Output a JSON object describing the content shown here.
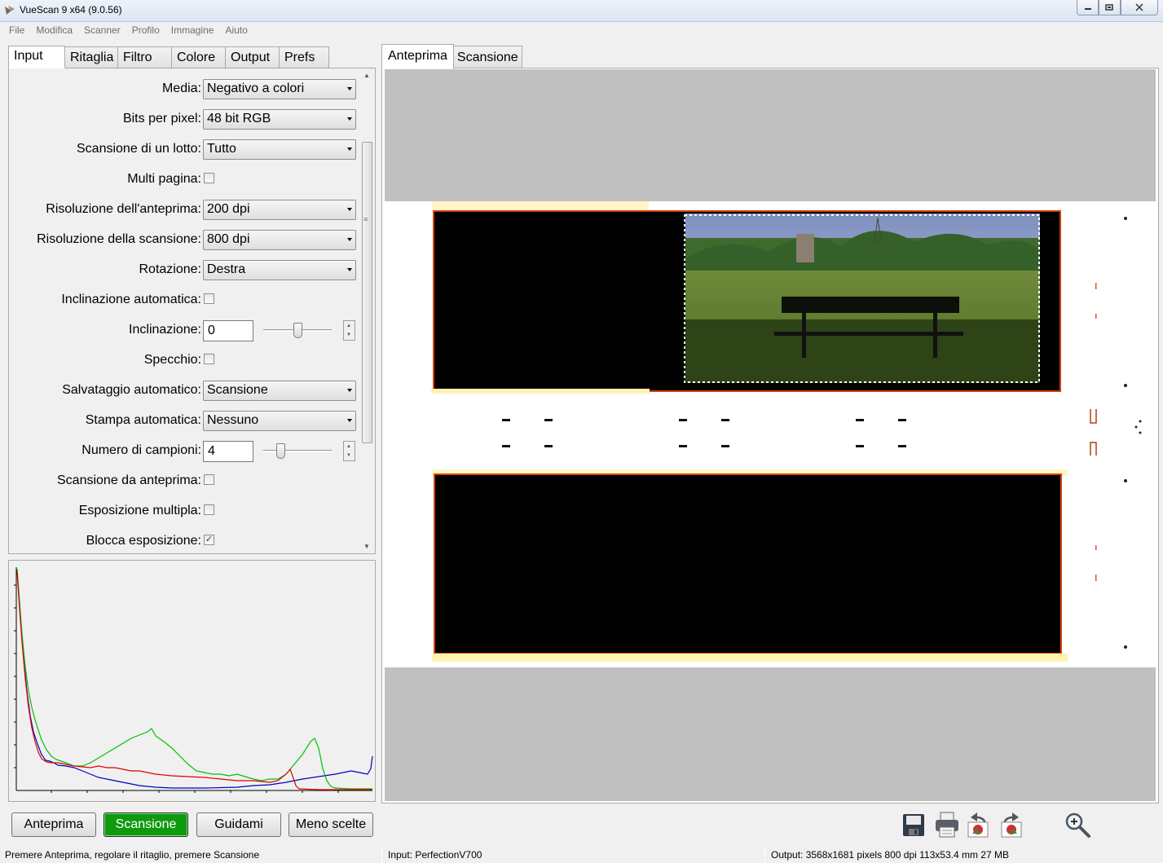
{
  "window": {
    "title": "VueScan 9 x64 (9.0.56)",
    "controls": [
      "minimize",
      "maximize",
      "close"
    ]
  },
  "menu": [
    "File",
    "Modifica",
    "Scanner",
    "Profilo",
    "Immagine",
    "Aiuto"
  ],
  "left_tabs": [
    "Input",
    "Ritaglia",
    "Filtro",
    "Colore",
    "Output",
    "Prefs"
  ],
  "active_left_tab": "Input",
  "form": {
    "media": {
      "label": "Media:",
      "value": "Negativo a colori"
    },
    "bits": {
      "label": "Bits per pixel:",
      "value": "48 bit RGB"
    },
    "batch": {
      "label": "Scansione di un lotto:",
      "value": "Tutto"
    },
    "multipage": {
      "label": "Multi pagina:",
      "checked": false
    },
    "preview_res": {
      "label": "Risoluzione dell'anteprima:",
      "value": "200 dpi"
    },
    "scan_res": {
      "label": "Risoluzione della scansione:",
      "value": "800 dpi"
    },
    "rotation": {
      "label": "Rotazione:",
      "value": "Destra"
    },
    "auto_skew": {
      "label": "Inclinazione automatica:",
      "checked": false
    },
    "skew": {
      "label": "Inclinazione:",
      "value": "0",
      "slider": 0.5
    },
    "mirror": {
      "label": "Specchio:",
      "checked": false
    },
    "auto_save": {
      "label": "Salvataggio automatico:",
      "value": "Scansione"
    },
    "auto_print": {
      "label": "Stampa automatica:",
      "value": "Nessuno"
    },
    "samples": {
      "label": "Numero di campioni:",
      "value": "4",
      "slider": 0.25
    },
    "scan_from_preview": {
      "label": "Scansione da anteprima:",
      "checked": false
    },
    "multi_exposure": {
      "label": "Esposizione multipla:",
      "checked": false
    },
    "lock_exposure": {
      "label": "Blocca esposizione:",
      "checked": true
    }
  },
  "buttons": {
    "preview": "Anteprima",
    "scan": "Scansione",
    "guide": "Guidami",
    "less_options": "Meno scelte"
  },
  "right_tabs": [
    "Anteprima",
    "Scansione"
  ],
  "active_right_tab": "Anteprima",
  "toolbar_icons": [
    "save-icon",
    "print-icon",
    "rotate-left-icon",
    "rotate-right-icon",
    "zoom-in-icon"
  ],
  "status": {
    "left": "Premere Anteprima, regolare il ritaglio, premere Scansione",
    "middle": "Input: PerfectionV700",
    "right": "Output: 3568x1681 pixels 800 dpi 113x53.4 mm 27 MB"
  },
  "colors": {
    "scan_button": "#0e9a0e",
    "histogram_red": "#e00000",
    "histogram_green": "#00c000",
    "histogram_blue": "#0000c0"
  }
}
